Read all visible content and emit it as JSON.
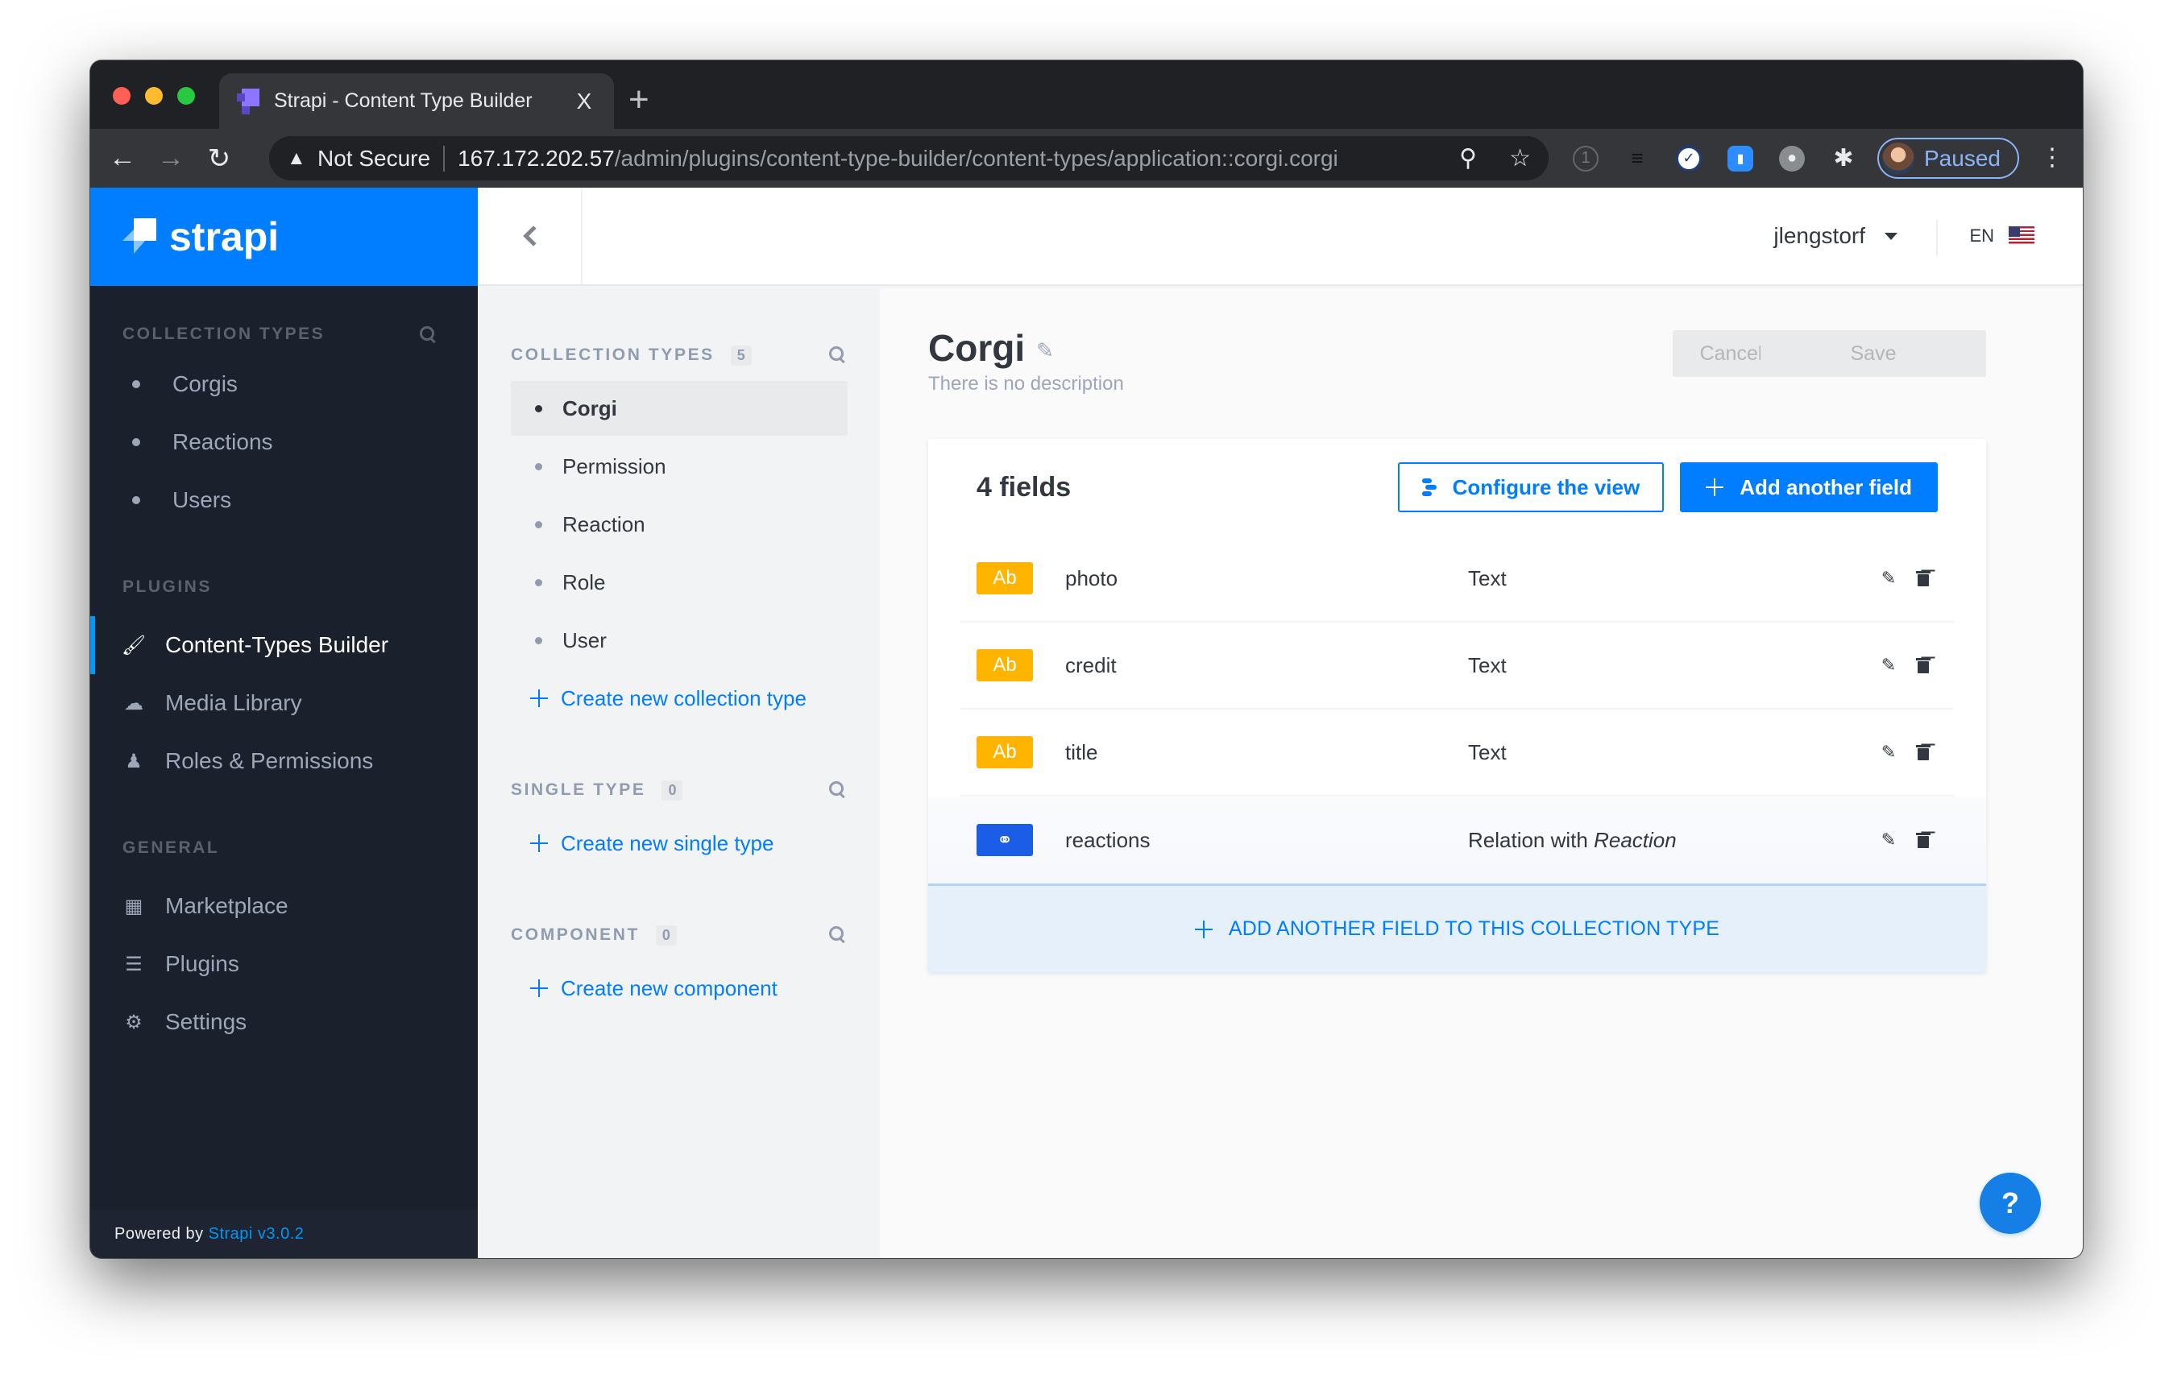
{
  "browser": {
    "tab_title": "Strapi - Content Type Builder",
    "tab_close": "X",
    "new_tab": "+",
    "security_label": "Not Secure",
    "url_host": "167.172.202.57",
    "url_path": "/admin/plugins/content-type-builder/content-types/application::corgi.corgi",
    "profile_label": "Paused",
    "icons": [
      "back-arrow",
      "forward-arrow",
      "reload",
      "warning",
      "key",
      "star",
      "1password",
      "buffer",
      "check-extension",
      "zoom-extension",
      "bird-extension",
      "puzzle-extensions",
      "kebab-menu"
    ]
  },
  "sidebar": {
    "brand": "strapi",
    "sections": [
      {
        "heading": "Collection Types",
        "items": [
          {
            "label": "Corgis"
          },
          {
            "label": "Reactions"
          },
          {
            "label": "Users"
          }
        ]
      },
      {
        "heading": "Plugins",
        "items": [
          {
            "label": "Content-Types Builder",
            "icon": "paintbrush",
            "active": true
          },
          {
            "label": "Media Library",
            "icon": "cloud-upload"
          },
          {
            "label": "Roles & Permissions",
            "icon": "users"
          }
        ]
      },
      {
        "heading": "General",
        "items": [
          {
            "label": "Marketplace",
            "icon": "basket"
          },
          {
            "label": "Plugins",
            "icon": "list"
          },
          {
            "label": "Settings",
            "icon": "gear"
          }
        ]
      }
    ],
    "powered_by": "Powered by",
    "powered_link": "Strapi v3.0.2"
  },
  "header": {
    "username": "jlengstorf",
    "language": "EN"
  },
  "subnav": {
    "collection_types": {
      "heading": "Collection Types",
      "count": "5",
      "items": [
        "Corgi",
        "Permission",
        "Reaction",
        "Role",
        "User"
      ],
      "active": "Corgi",
      "create_label": "Create new collection type"
    },
    "single_type": {
      "heading": "Single Type",
      "count": "0",
      "create_label": "Create new single type"
    },
    "component": {
      "heading": "Component",
      "count": "0",
      "create_label": "Create new component"
    }
  },
  "main": {
    "title": "Corgi",
    "description": "There is no description",
    "cancel_label": "Cancel",
    "save_label": "Save",
    "fields_count": "4 fields",
    "configure_label": "Configure the view",
    "add_field_label": "Add another field",
    "fields": [
      {
        "badge": "Ab",
        "kind": "text",
        "name": "photo",
        "type": "Text"
      },
      {
        "badge": "Ab",
        "kind": "text",
        "name": "credit",
        "type": "Text"
      },
      {
        "badge": "Ab",
        "kind": "text",
        "name": "title",
        "type": "Text"
      },
      {
        "badge": "",
        "kind": "relation",
        "name": "reactions",
        "type": "Relation with",
        "type_target": "Reaction"
      }
    ],
    "add_footer_label": "ADD ANOTHER FIELD TO THIS COLLECTION TYPE"
  },
  "help_label": "?",
  "colors": {
    "brand_blue": "#007eff",
    "sidebar_bg": "#1b202d",
    "text_badge": "#ffb500",
    "relation_badge": "#1c5de7"
  }
}
